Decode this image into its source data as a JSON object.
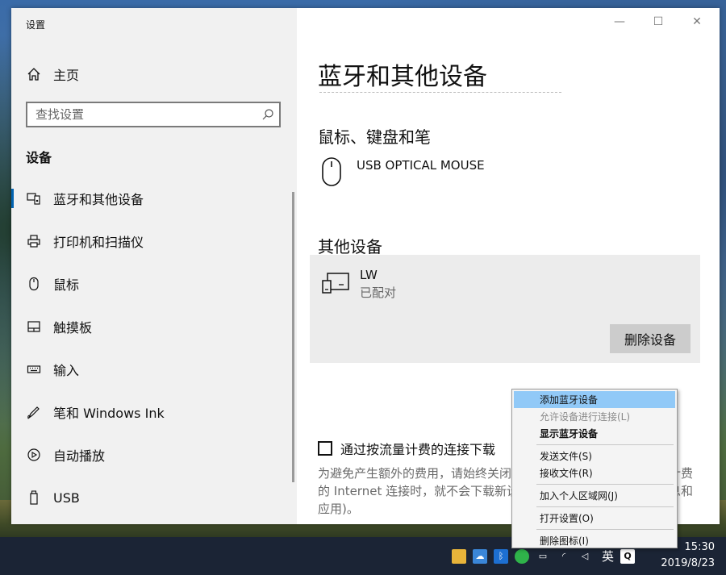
{
  "window": {
    "title": "设置",
    "controls": {
      "minimize": "—",
      "maximize": "☐",
      "close": "✕"
    }
  },
  "sidebar": {
    "home_label": "主页",
    "search_placeholder": "查找设置",
    "section": "设备",
    "items": [
      {
        "label": "蓝牙和其他设备",
        "icon": "bluetooth-devices-icon",
        "active": true
      },
      {
        "label": "打印机和扫描仪",
        "icon": "printer-icon"
      },
      {
        "label": "鼠标",
        "icon": "mouse-icon"
      },
      {
        "label": "触摸板",
        "icon": "touchpad-icon"
      },
      {
        "label": "输入",
        "icon": "keyboard-icon"
      },
      {
        "label": "笔和 Windows Ink",
        "icon": "pen-icon"
      },
      {
        "label": "自动播放",
        "icon": "autoplay-icon"
      },
      {
        "label": "USB",
        "icon": "usb-icon"
      }
    ]
  },
  "main": {
    "title": "蓝牙和其他设备",
    "mouse_section": "鼠标、键盘和笔",
    "mouse_device": "USB OPTICAL MOUSE",
    "other_section": "其他设备",
    "other_device": {
      "name": "LW",
      "status": "已配对",
      "remove_label": "删除设备"
    },
    "metered_checkbox": {
      "label": "通过按流量计费的连接下载",
      "checked": false
    },
    "metered_desc": "为避免产生额外的费用，请始终关闭此设置，这样在你使用按流量计费的 Internet 连接时，就不会下载新设备的设备软件(驱动程序、信息和应用)。"
  },
  "context_menu": {
    "items": [
      {
        "label": "添加蓝牙设备",
        "highlight": true
      },
      {
        "label": "允许设备进行连接(L)",
        "disabled": true
      },
      {
        "label": "显示蓝牙设备",
        "bold": true
      },
      {
        "sep": true
      },
      {
        "label": "发送文件(S)"
      },
      {
        "label": "接收文件(R)"
      },
      {
        "sep": true
      },
      {
        "label": "加入个人区域网(J)"
      },
      {
        "sep": true
      },
      {
        "label": "打开设置(O)"
      },
      {
        "sep": true
      },
      {
        "label": "删除图标(I)"
      }
    ]
  },
  "taskbar": {
    "language": "英",
    "time": "15:30",
    "date": "2019/8/23"
  },
  "colors": {
    "accent": "#0063b1",
    "menu_highlight": "#91c9f7",
    "taskbar": "#1b2435"
  }
}
